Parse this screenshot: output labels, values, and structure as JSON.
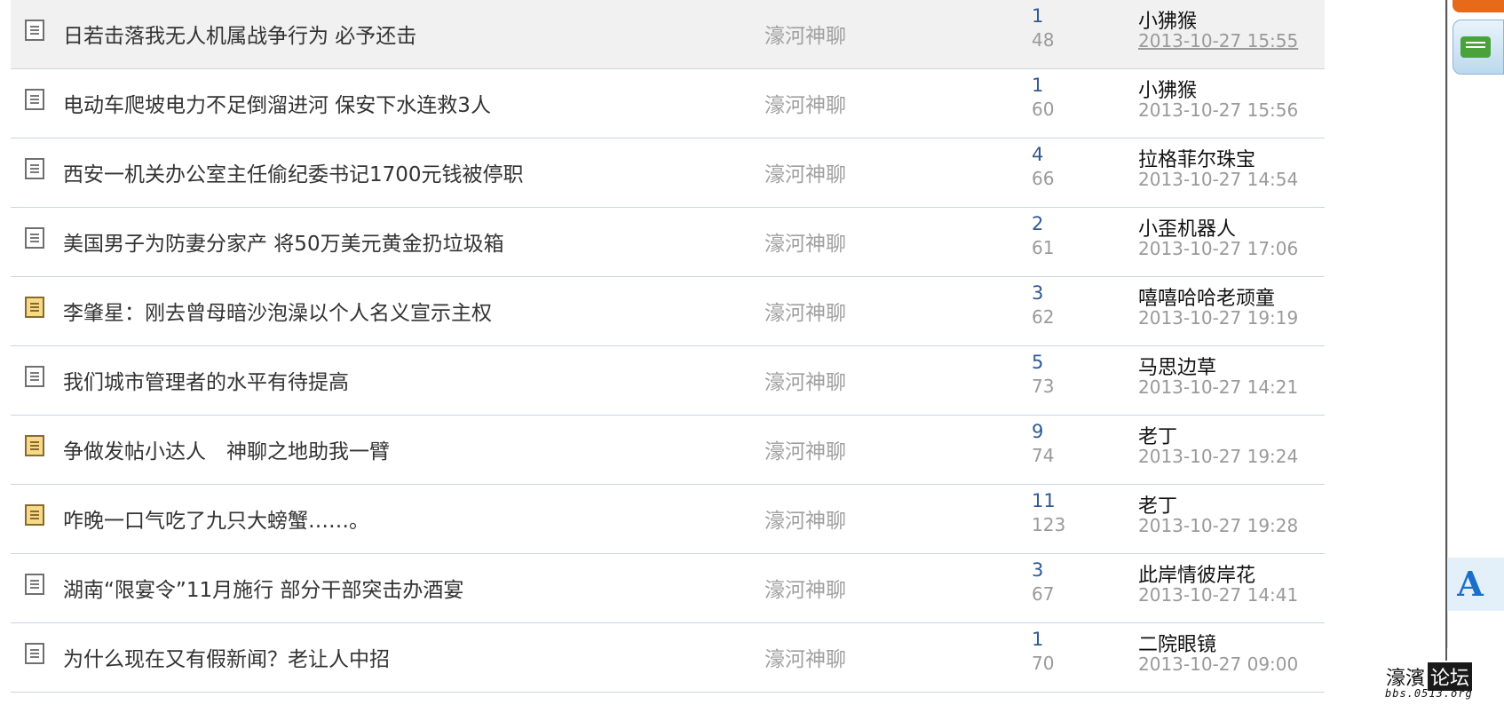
{
  "threads": [
    {
      "title": "日若击落我无人机属战争行为 必予还击",
      "forum": "濠河神聊",
      "replies": "1",
      "views": "48",
      "last_user": "小狒猴",
      "last_time": "2013-10-27 15:55",
      "icon": "doc-gray-icon"
    },
    {
      "title": "电动车爬坡电力不足倒溜进河 保安下水连救3人",
      "forum": "濠河神聊",
      "replies": "1",
      "views": "60",
      "last_user": "小狒猴",
      "last_time": "2013-10-27 15:56",
      "icon": "doc-gray-icon"
    },
    {
      "title": "西安一机关办公室主任偷纪委书记1700元钱被停职",
      "forum": "濠河神聊",
      "replies": "4",
      "views": "66",
      "last_user": "拉格菲尔珠宝",
      "last_time": "2013-10-27 14:54",
      "icon": "doc-gray-icon"
    },
    {
      "title": "美国男子为防妻分家产 将50万美元黄金扔垃圾箱",
      "forum": "濠河神聊",
      "replies": "2",
      "views": "61",
      "last_user": "小歪机器人",
      "last_time": "2013-10-27 17:06",
      "icon": "doc-gray-icon"
    },
    {
      "title": "李肇星：刚去曾母暗沙泡澡以个人名义宣示主权",
      "forum": "濠河神聊",
      "replies": "3",
      "views": "62",
      "last_user": "嘻嘻哈哈老顽童",
      "last_time": "2013-10-27 19:19",
      "icon": "doc-yellow-icon"
    },
    {
      "title": "我们城市管理者的水平有待提高",
      "forum": "濠河神聊",
      "replies": "5",
      "views": "73",
      "last_user": "马思边草",
      "last_time": "2013-10-27 14:21",
      "icon": "doc-gray-icon"
    },
    {
      "title": "争做发帖小达人　神聊之地助我一臂",
      "forum": "濠河神聊",
      "replies": "9",
      "views": "74",
      "last_user": "老丁",
      "last_time": "2013-10-27 19:24",
      "icon": "doc-yellow-icon"
    },
    {
      "title": "咋晚一口气吃了九只大螃蟹……。",
      "forum": "濠河神聊",
      "replies": "11",
      "views": "123",
      "last_user": "老丁",
      "last_time": "2013-10-27 19:28",
      "icon": "doc-yellow-icon"
    },
    {
      "title": "湖南“限宴令”11月施行 部分干部突击办酒宴",
      "forum": "濠河神聊",
      "replies": "3",
      "views": "67",
      "last_user": "此岸情彼岸花",
      "last_time": "2013-10-27 14:41",
      "icon": "doc-gray-icon"
    },
    {
      "title": "为什么现在又有假新闻？老让人中招",
      "forum": "濠河神聊",
      "replies": "1",
      "views": "70",
      "last_user": "二院眼镜",
      "last_time": "2013-10-27 09:00",
      "icon": "doc-gray-icon"
    }
  ],
  "side": {
    "font_button": "A"
  },
  "watermark": {
    "name": "濠濱",
    "box": "论坛",
    "url": "bbs.0513.org"
  }
}
